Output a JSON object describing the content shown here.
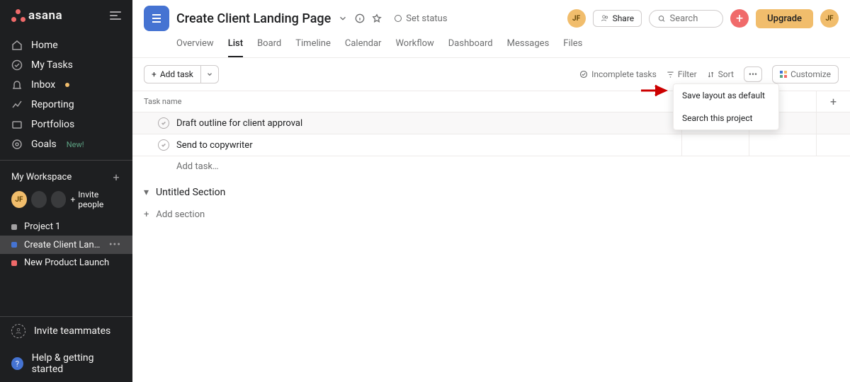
{
  "brand": "asana",
  "sidebar": {
    "nav": [
      {
        "label": "Home"
      },
      {
        "label": "My Tasks"
      },
      {
        "label": "Inbox"
      },
      {
        "label": "Reporting"
      },
      {
        "label": "Portfolios"
      },
      {
        "label": "Goals",
        "badge": "New!"
      }
    ],
    "workspace": {
      "title": "My Workspace",
      "invite": "Invite people",
      "avatar": "JF",
      "projects": [
        {
          "name": "Project 1",
          "color": "#a2a0a2"
        },
        {
          "name": "Create Client Landin…",
          "color": "#4573d2",
          "active": true
        },
        {
          "name": "New Product Launch",
          "color": "#f06a6a"
        }
      ]
    },
    "bottom": {
      "invite_teammates": "Invite teammates",
      "help": "Help & getting started"
    }
  },
  "header": {
    "title": "Create Client Landing Page",
    "set_status": "Set status",
    "share": "Share",
    "search_placeholder": "Search",
    "upgrade": "Upgrade",
    "avatar": "JF",
    "tabs": [
      "Overview",
      "List",
      "Board",
      "Timeline",
      "Calendar",
      "Workflow",
      "Dashboard",
      "Messages",
      "Files"
    ],
    "active_tab": "List"
  },
  "toolbar": {
    "add_task": "Add task",
    "incomplete": "Incomplete tasks",
    "filter": "Filter",
    "sort": "Sort",
    "customize": "Customize"
  },
  "dropdown": {
    "items": [
      "Save layout as default",
      "Search this project"
    ]
  },
  "columns": {
    "task_name": "Task name"
  },
  "tasks": [
    {
      "name": "Draft outline for client approval",
      "highlight": true
    },
    {
      "name": "Send to copywriter"
    }
  ],
  "add_task_placeholder": "Add task…",
  "section": {
    "untitled": "Untitled Section",
    "add": "Add section"
  }
}
